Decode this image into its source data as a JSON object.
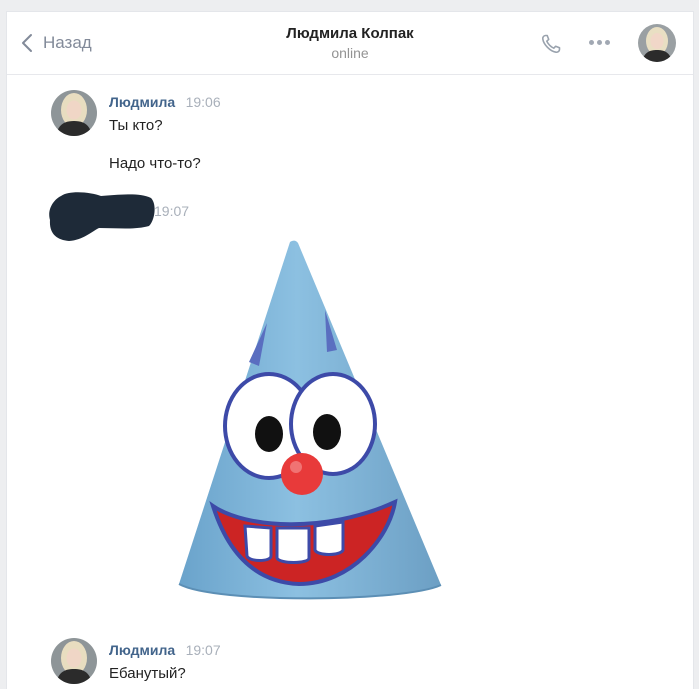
{
  "header": {
    "back_label": "Назад",
    "title": "Людмила Колпак",
    "status": "online"
  },
  "messages": [
    {
      "author": "Людмила",
      "time": "19:06",
      "lines": [
        "Ты кто?",
        "Надо что-то?"
      ]
    },
    {
      "author": "",
      "time": "19:07",
      "attachment": "party-hat-photo"
    },
    {
      "author": "Людмила",
      "time": "19:07",
      "lines": [
        "Ебанутый?"
      ]
    }
  ],
  "colors": {
    "author_link": "#42648b",
    "muted": "#939393",
    "hat_blue": "#7fb4d8",
    "nose_red": "#e83a3a"
  }
}
